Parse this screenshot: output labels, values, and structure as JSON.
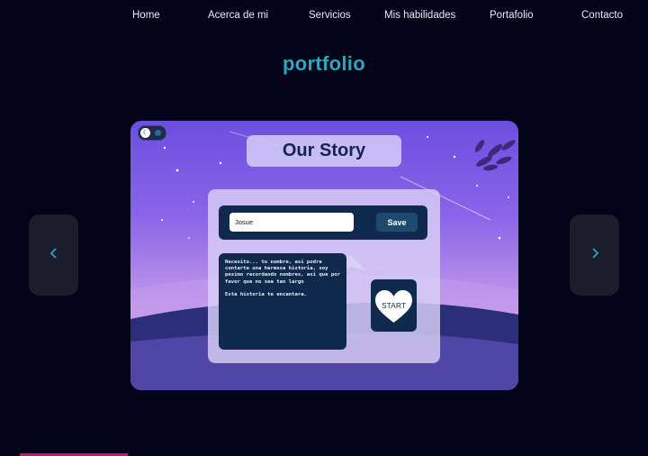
{
  "nav": {
    "items": [
      {
        "label": "Home"
      },
      {
        "label": "Acerca de mi"
      },
      {
        "label": "Servicios"
      },
      {
        "label": "Mis habilidades"
      },
      {
        "label": "Portafolio"
      },
      {
        "label": "Contacto"
      }
    ]
  },
  "section": {
    "title": "portfolio"
  },
  "carousel": {
    "prev_icon": "chevron-left-icon",
    "next_icon": "chevron-right-icon",
    "arrow_color": "#2ea6be"
  },
  "slide": {
    "title": "Our Story",
    "name_value": "Josue",
    "save_label": "Save",
    "story_paragraph_1": "Necesito... tu nombre, asi podre contarte una hermosa historia, soy pesimo recordando nombres, asi que por favor que no sea tan largo",
    "story_paragraph_2": "Esta historia te encantara.",
    "start_label": "START",
    "colors": {
      "panel_dark": "#0f2a4c",
      "title_text": "#14244f",
      "accent": "#2ea6be"
    }
  }
}
